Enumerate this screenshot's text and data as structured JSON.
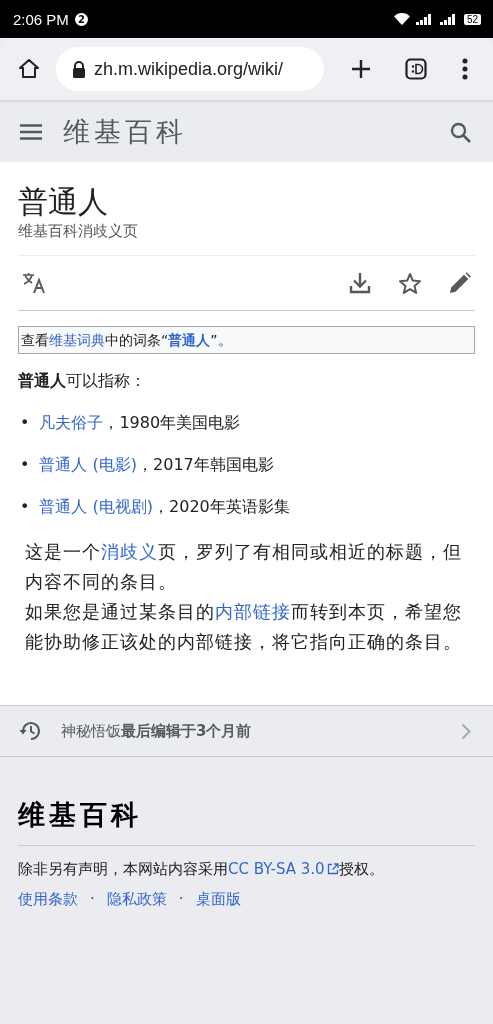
{
  "status_bar": {
    "time": "2:06 PM",
    "notification_count": "2",
    "battery": "52"
  },
  "browser": {
    "url": "zh.m.wikipedia.org/wiki/"
  },
  "header": {
    "logo": "维基百科"
  },
  "page": {
    "title": "普通人",
    "subtitle": "维基百科消歧义页",
    "wiktionary_note": [
      {
        "kind": "text",
        "text": "查看"
      },
      {
        "kind": "link",
        "text": "维基词典"
      },
      {
        "kind": "text",
        "text": "中的词条“"
      },
      {
        "kind": "boldlink",
        "text": "普通人"
      },
      {
        "kind": "text",
        "text": "”。"
      }
    ],
    "intro": "**普通人**可以指称：",
    "items": [
      {
        "bullet": "•",
        "segments": [
          {
            "kind": "link",
            "text": "凡夫俗子"
          },
          {
            "kind": "text",
            "text": "，1980年美国电影"
          }
        ]
      },
      {
        "bullet": "•",
        "segments": [
          {
            "kind": "link",
            "text": "普通人 (电影)"
          },
          {
            "kind": "text",
            "text": "，2017年韩国电影"
          }
        ]
      },
      {
        "bullet": "•",
        "segments": [
          {
            "kind": "link",
            "text": "普通人 (电视剧)"
          },
          {
            "kind": "text",
            "text": "，2020年英语影集"
          }
        ]
      }
    ],
    "notes": [
      [
        {
          "kind": "text",
          "text": "这是一个"
        },
        {
          "kind": "link",
          "text": "消歧义"
        },
        {
          "kind": "text",
          "text": "页，罗列了有相同或相近的标题，但内容不同的条目。"
        }
      ],
      [
        {
          "kind": "text",
          "text": "如果您是通过某条目的"
        },
        {
          "kind": "link",
          "text": "内部链接"
        },
        {
          "kind": "text",
          "text": "而转到本页，希望您能协助修正该处的内部链接，将它指向正确的条目。"
        }
      ]
    ]
  },
  "last_edited": {
    "text": "神秘悟饭**最后编辑于3个月前**"
  },
  "footer": {
    "logo": "维基百科",
    "license": [
      {
        "kind": "text",
        "text": "除非另有声明，本网站内容采用"
      },
      {
        "kind": "extlink",
        "text": "CC BY-SA 3.0"
      },
      {
        "kind": "text",
        "text": "授权。"
      }
    ],
    "links": [
      {
        "kind": "link",
        "text": "使用条款"
      },
      {
        "kind": "sep",
        "text": "·"
      },
      {
        "kind": "link",
        "text": "隐私政策"
      },
      {
        "kind": "sep",
        "text": "·"
      },
      {
        "kind": "link",
        "text": "桌面版"
      }
    ]
  }
}
